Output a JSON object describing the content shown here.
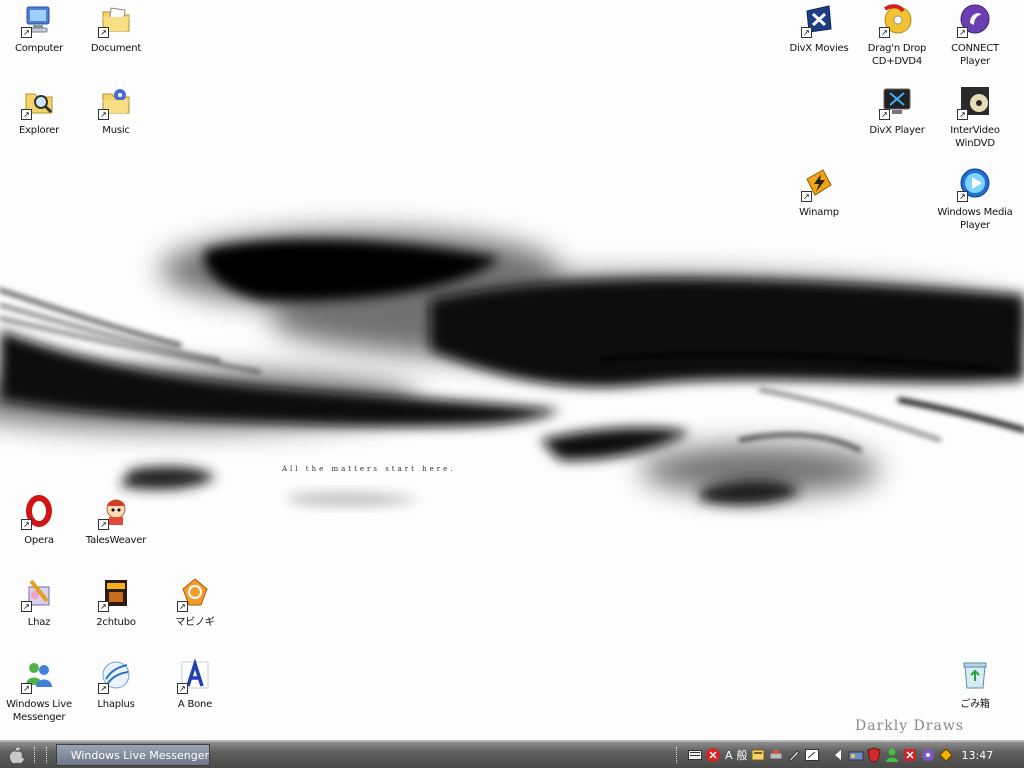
{
  "desktop": {
    "motto": "All the matters start here.",
    "signature": "Darkly Draws",
    "icons": [
      {
        "label": "Computer"
      },
      {
        "label": "Document"
      },
      {
        "label": "Explorer"
      },
      {
        "label": "Music"
      },
      {
        "label": "DivX Movies"
      },
      {
        "label": "Drag'n Drop CD+DVD4"
      },
      {
        "label": "CONNECT Player"
      },
      {
        "label": "DivX Player"
      },
      {
        "label": "InterVideo WinDVD"
      },
      {
        "label": "Winamp"
      },
      {
        "label": "Windows Media Player"
      },
      {
        "label": "Opera"
      },
      {
        "label": "TalesWeaver"
      },
      {
        "label": "Lhaz"
      },
      {
        "label": "2chtubo"
      },
      {
        "label": "マビノギ"
      },
      {
        "label": "Windows Live Messenger"
      },
      {
        "label": "Lhaplus"
      },
      {
        "label": "A Bone"
      },
      {
        "label": "ごみ箱"
      }
    ]
  },
  "taskbar": {
    "task": "Windows Live Messenger",
    "ime_a": "A",
    "ime_mode": "般",
    "clock": "13:47"
  },
  "colors": {
    "taskbar": "#5e5e5e",
    "task_button": "#7b8594",
    "clock_text": "#ffffff"
  }
}
